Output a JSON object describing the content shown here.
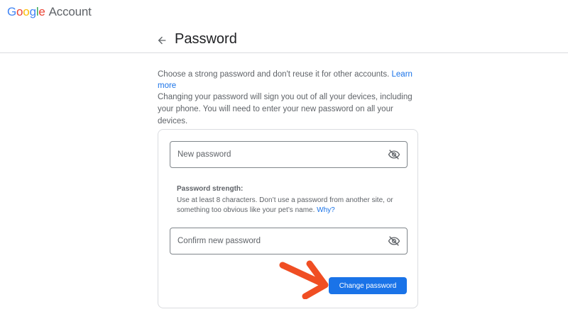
{
  "header": {
    "logo_letters": [
      "G",
      "o",
      "o",
      "g",
      "l",
      "e"
    ],
    "logo_suffix": "Account"
  },
  "page": {
    "title": "Password",
    "back_icon": "arrow-left-icon"
  },
  "intro": {
    "text": "Choose a strong password and don't reuse it for other accounts.",
    "link": "Learn more"
  },
  "warning": {
    "text": "Changing your password will sign you out of all your devices, including your phone. You will need to enter your new password on all your devices."
  },
  "form": {
    "new_password": {
      "placeholder": "New password",
      "value": "",
      "toggle_icon": "visibility-off-icon"
    },
    "strength": {
      "title": "Password strength:",
      "text": "Use at least 8 characters. Don’t use a password from another site, or something too obvious like your pet’s name.",
      "link": "Why?"
    },
    "confirm_password": {
      "placeholder": "Confirm new password",
      "value": "",
      "toggle_icon": "visibility-off-icon"
    },
    "submit_label": "Change password"
  },
  "annotation": {
    "icon": "red-arrow-icon",
    "color": "#f04e23"
  },
  "colors": {
    "accent": "#1a73e8",
    "annotation": "#f04e23"
  }
}
